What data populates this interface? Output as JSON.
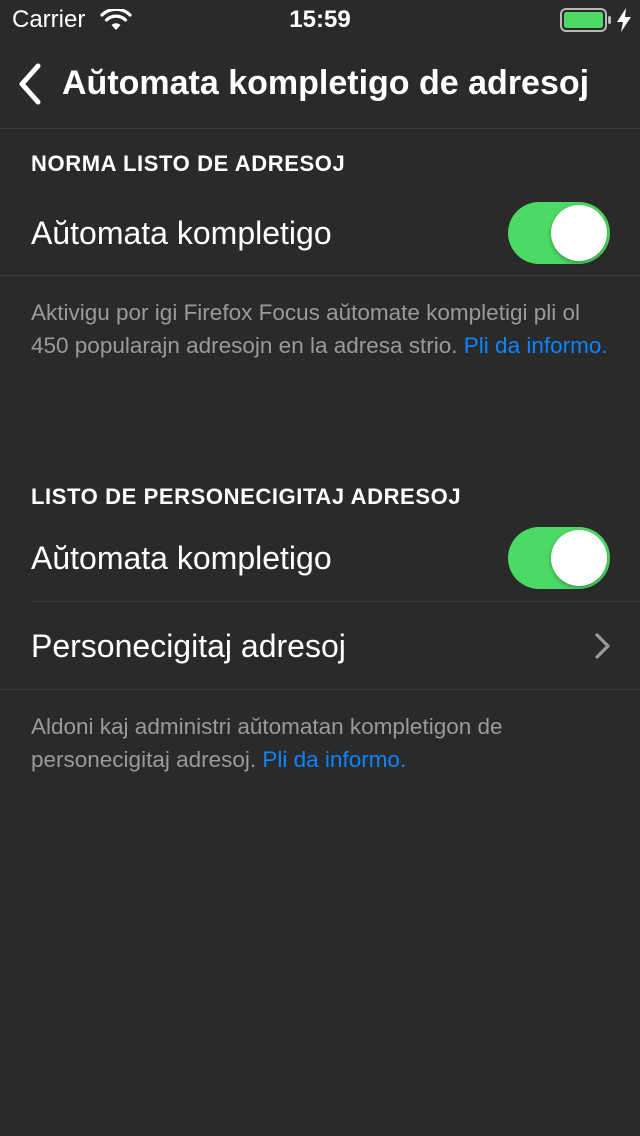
{
  "status_bar": {
    "carrier": "Carrier",
    "time": "15:59",
    "icons": [
      "wifi-icon",
      "battery-icon",
      "charging-bolt-icon"
    ]
  },
  "nav": {
    "title": "Aŭtomata kompletigo de adresoj",
    "back_icon": "chevron-left-icon"
  },
  "default_list": {
    "header": "NORMA LISTO DE ADRESOJ",
    "toggle_label": "Aŭtomata kompletigo",
    "toggle_on": true,
    "footer_text": "Aktivigu por igi Firefox Focus aŭtomate kompletigi pli ol 450 popularajn adresojn en la adresa strio. ",
    "footer_link": "Pli da informo."
  },
  "custom_list": {
    "header": "LISTO DE PERSONECIGITAJ ADRESOJ",
    "toggle_label": "Aŭtomata kompletigo",
    "toggle_on": true,
    "custom_urls_label": "Personecigitaj adresoj",
    "footer_text": "Aldoni kaj administri aŭtomatan kompletigon de personecigitaj adresoj. ",
    "footer_link": "Pli da informo."
  },
  "colors": {
    "background": "#2a2a2b",
    "toggle_on": "#4cd964",
    "link": "#0a84ff",
    "secondary_text": "#9a9a9e",
    "battery": "#4cd964"
  }
}
